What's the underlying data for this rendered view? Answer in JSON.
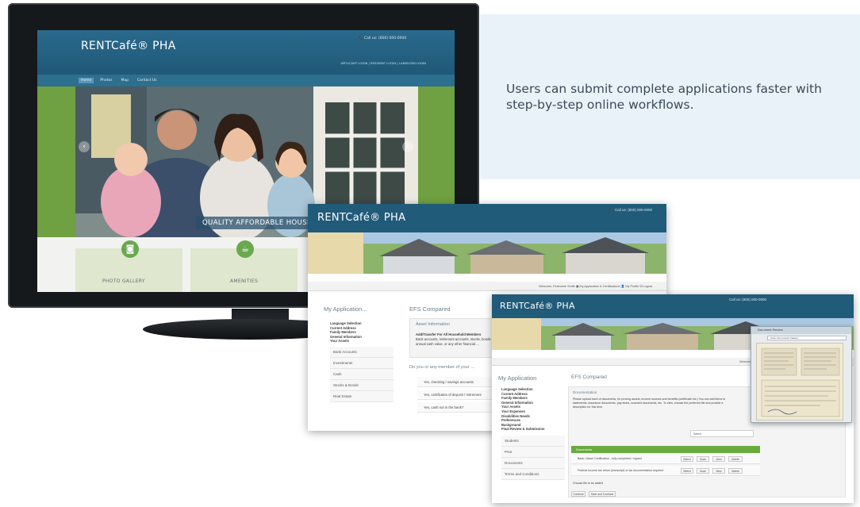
{
  "caption": "Users can submit complete applications faster with step-by-step online workflows.",
  "site_a": {
    "brand": "RENTCafé® PHA",
    "phone": "📞 Call us: (800) 000-0000",
    "top_links": "APPLICANT LOGIN  |  RESIDENT LOGIN  |  LANDLORD LOGIN",
    "nav": [
      "Home",
      "Photos",
      "Map",
      "Contact Us"
    ],
    "hero_caption": "QUALITY AFFORDABLE HOUSING",
    "tiles": [
      {
        "label": "PHOTO GALLERY",
        "icon": "camera-icon"
      },
      {
        "label": "AMENITIES",
        "icon": "coffee-icon"
      }
    ]
  },
  "site_b": {
    "brand": "RENTCafé® PHA",
    "phone": "📞 Call us: (800) 000-0000",
    "userbar": "Welcome, Firstname Smith   ▣ My Application & Certifications   👤 My Profile   ⏻ Logout",
    "side_title": "My Application...",
    "main_title": "EFS Compared",
    "steps": [
      "Language Selection",
      "Current Address",
      "Family Members",
      "General Information",
      "Your Assets"
    ],
    "sub_items": [
      "Bank Accounts",
      "Investments",
      "Cash",
      "Stocks & Bonds",
      "Real Estate"
    ],
    "asset_heading": "Asset Information",
    "asset_text": [
      "Add/Transfer For All Household Members",
      "Bank accounts, retirement accounts, stocks, bonds and",
      "annual cash value, or any other financial ..."
    ],
    "question": "Do you or any member of your ...",
    "rows": [
      "Yes, checking / savings accounts",
      "Yes, certificates of deposit / retirement",
      "Yes, cash not in the bank?"
    ]
  },
  "site_c": {
    "brand": "RENTCafé® PHA",
    "phone": "📞 Call us: (800) 000-0000",
    "userbar": "Welcome, Firstname Smith   ▣ My Application & Certifications   👤 My Profile",
    "side_title": "My Application",
    "main_title": "EFS Compared",
    "steps": [
      "Language Selection",
      "Current Address",
      "Family Members",
      "General Information",
      "Your Assets",
      "Your Expenses",
      "Disabilities Needs",
      "Preferences",
      "Background",
      "Final Review & Submission"
    ],
    "sub_items": [
      "Students",
      "Prior",
      "Documents",
      "Terms and Conditions"
    ],
    "intro_heading": "Documentation",
    "intro_text": [
      "Please upload each of documents, for proving assets, income sources and benefits (certificate etc.) You can add items to",
      "statements, insurance documents, pay stubs, scanned documents, etc. To view, choose the preferred file and provide a",
      "description for this item."
    ],
    "select_label": "Select",
    "green_header": "Documents",
    "rows": [
      "Bank / Asset Certification - fully completed / signed",
      "Federal Income tax return (transcript) or tax documentation required"
    ],
    "row_buttons": [
      "Select",
      "Scan",
      "View",
      "Delete"
    ],
    "footnote": "Choose file to be added",
    "buttons": [
      "Continue",
      "Save and Continue"
    ]
  },
  "popup": {
    "title": "Document Preview",
    "url": "Scan Document Viewer"
  }
}
